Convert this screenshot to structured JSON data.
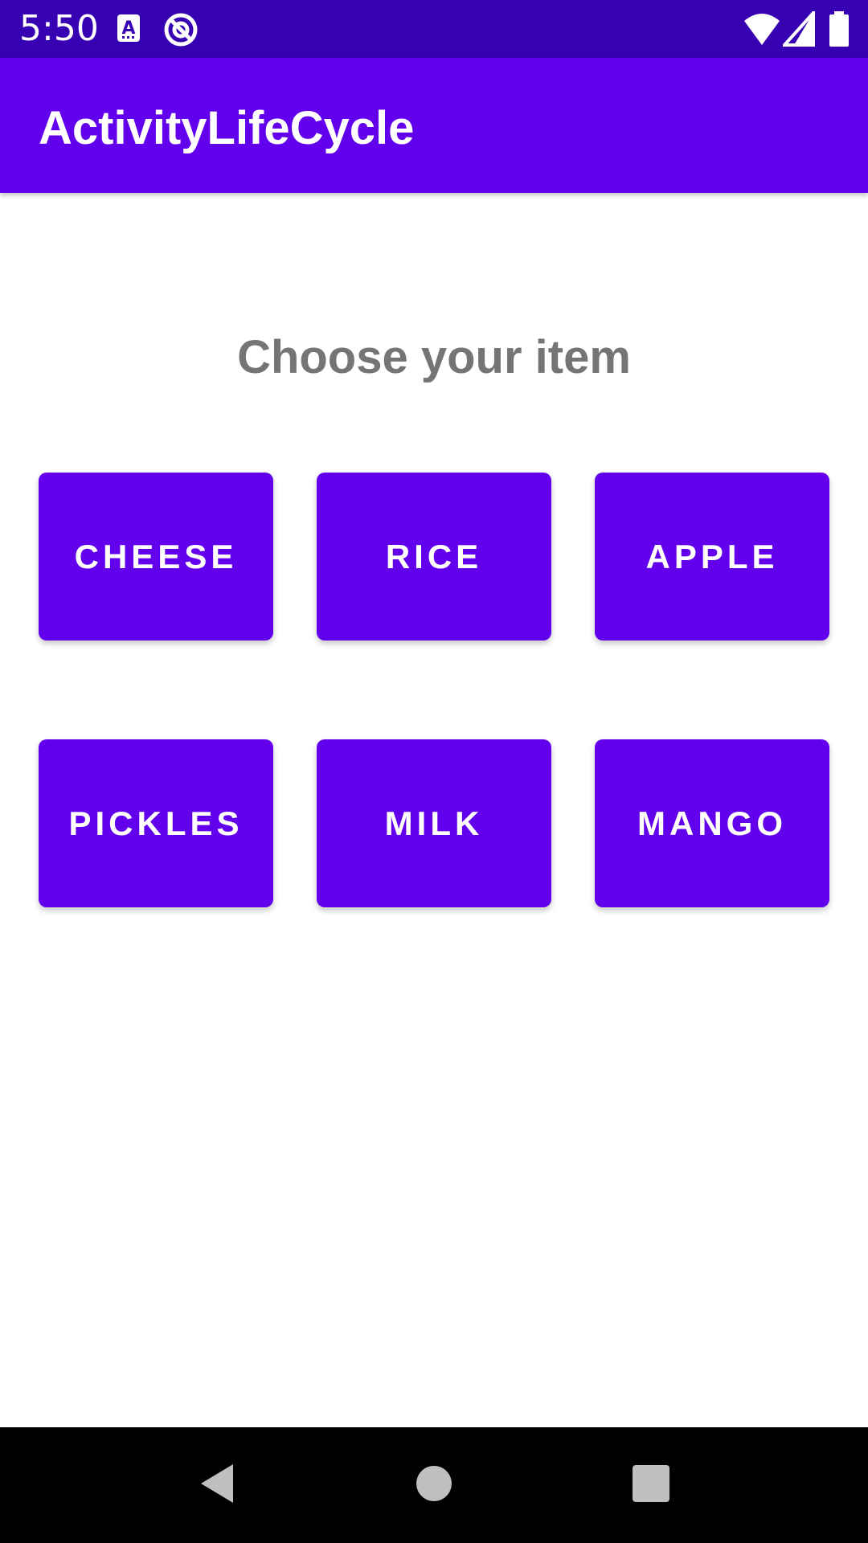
{
  "status_bar": {
    "time": "5:50",
    "icons": [
      "text-input-notification-icon",
      "do-not-disturb-icon",
      "wifi-icon",
      "cellular-signal-icon",
      "battery-icon"
    ]
  },
  "app_bar": {
    "title": "ActivityLifeCycle"
  },
  "main": {
    "prompt": "Choose your item",
    "buttons": [
      {
        "label": "CHEESE"
      },
      {
        "label": "RICE"
      },
      {
        "label": "APPLE"
      },
      {
        "label": "PICKLES"
      },
      {
        "label": "MILK"
      },
      {
        "label": "MANGO"
      }
    ]
  },
  "nav_bar": {
    "icons": [
      "back-icon",
      "home-icon",
      "recents-icon"
    ]
  },
  "colors": {
    "status_bar": "#3700b3",
    "primary": "#6200ee",
    "prompt_text": "#757575",
    "nav_bar": "#000000"
  }
}
